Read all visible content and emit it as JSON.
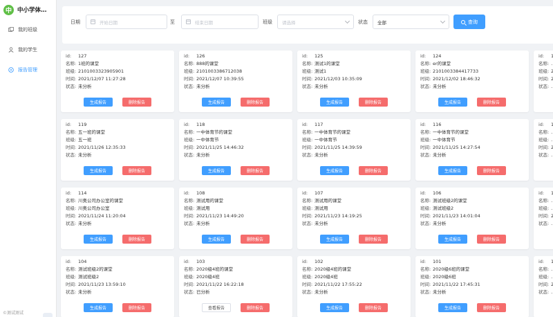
{
  "sidebar": {
    "brand_logo": "中",
    "brand_name": "中小学体…",
    "items": [
      {
        "label": "我的班级",
        "icon": "class-icon",
        "active": false
      },
      {
        "label": "我的学生",
        "icon": "user-icon",
        "active": false
      },
      {
        "label": "报告管理",
        "icon": "report-icon",
        "active": true
      }
    ],
    "footer_text": "©测试测试"
  },
  "filter": {
    "date_label": "日期",
    "start_placeholder": "开始日期",
    "range_sep": "至",
    "end_placeholder": "结束日期",
    "class_label": "班级",
    "class_placeholder": "请选择",
    "status_label": "状态",
    "status_value": "全部",
    "query_label": "查询"
  },
  "field_labels": {
    "id": "id:",
    "name": "名称:",
    "class": "班级:",
    "time": "时间:",
    "status": "状态:"
  },
  "buttons": {
    "generate": "生成报告",
    "view": "查看报告",
    "delete": "删除报告"
  },
  "colors": {
    "primary": "#409eff",
    "danger": "#f56c6c",
    "brand": "#5fbf46"
  },
  "cards": [
    [
      {
        "id": "127",
        "name": "1班的课堂",
        "class": "2101003323905901",
        "time": "2021/12/07 11:27:28",
        "status": "未分析",
        "action": "generate"
      },
      {
        "id": "126",
        "name": "888的课堂",
        "class": "2101003386712038",
        "time": "2021/12/07 10:39:55",
        "status": "未分析",
        "action": "generate"
      },
      {
        "id": "125",
        "name": "测试1的课堂",
        "class": "测试1",
        "time": "2021/12/03 10:35:09",
        "status": "未分析",
        "action": "generate"
      },
      {
        "id": "124",
        "name": "er的课堂",
        "class": "2101003384417733",
        "time": "2021/12/02 18:46:32",
        "status": "未分析",
        "action": "generate"
      },
      {
        "id": "1",
        "name": "…",
        "class": "2",
        "time": "2",
        "status": "…",
        "action": "generate"
      }
    ],
    [
      {
        "id": "119",
        "name": "五一班的课堂",
        "class": "五一班",
        "time": "2021/11/26 12:35:33",
        "status": "未分析",
        "action": "generate"
      },
      {
        "id": "118",
        "name": "一中体育节的课堂",
        "class": "一中体育节",
        "time": "2021/11/25 14:46:32",
        "status": "未分析",
        "action": "generate"
      },
      {
        "id": "117",
        "name": "一中体育节的课堂",
        "class": "一中体育节",
        "time": "2021/11/25 14:39:59",
        "status": "未分析",
        "action": "generate"
      },
      {
        "id": "116",
        "name": "一中体育节的课堂",
        "class": "一中体育节",
        "time": "2021/11/25 14:27:54",
        "status": "未分析",
        "action": "generate"
      },
      {
        "id": "1",
        "name": "…",
        "class": "…",
        "time": "2",
        "status": "…",
        "action": "generate"
      }
    ],
    [
      {
        "id": "114",
        "name": "川奥公司办公室的课堂",
        "class": "川奥公司办公室",
        "time": "2021/11/24 11:20:04",
        "status": "未分析",
        "action": "generate"
      },
      {
        "id": "108",
        "name": "测试用的课堂",
        "class": "测试用",
        "time": "2021/11/23 14:49:20",
        "status": "未分析",
        "action": "generate"
      },
      {
        "id": "107",
        "name": "测试用的课堂",
        "class": "测试用",
        "time": "2021/11/23 14:19:25",
        "status": "未分析",
        "action": "generate"
      },
      {
        "id": "106",
        "name": "测试班级2的课堂",
        "class": "测试班级2",
        "time": "2021/11/23 14:01:04",
        "status": "未分析",
        "action": "generate"
      },
      {
        "id": "1",
        "name": "…",
        "class": "…",
        "time": "2",
        "status": "…",
        "action": "generate"
      }
    ],
    [
      {
        "id": "104",
        "name": "测试班级2的课堂",
        "class": "测试班级2",
        "time": "2021/11/23 13:59:10",
        "status": "未分析",
        "action": "generate"
      },
      {
        "id": "103",
        "name": "2020级4班的课堂",
        "class": "2020级4班",
        "time": "2021/11/22 16:22:18",
        "status": "已分析",
        "action": "view"
      },
      {
        "id": "102",
        "name": "2020级4班的课堂",
        "class": "2020级4班",
        "time": "2021/11/22 17:55:22",
        "status": "未分析",
        "action": "generate"
      },
      {
        "id": "101",
        "name": "2020级6班的课堂",
        "class": "2020级6班",
        "time": "2021/11/22 17:45:31",
        "status": "未分析",
        "action": "generate"
      },
      {
        "id": "1",
        "name": "…",
        "class": "…",
        "time": "2",
        "status": "…",
        "action": "generate"
      }
    ]
  ]
}
